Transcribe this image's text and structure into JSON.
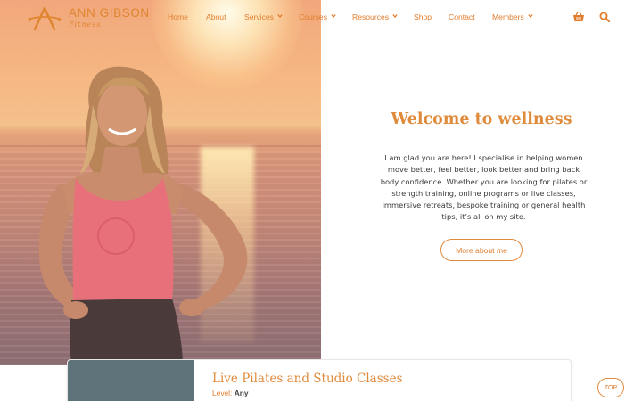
{
  "brand": {
    "name": "ANN GIBSON",
    "tagline": "Fitness",
    "accent_color": "#e07c2c"
  },
  "nav": [
    {
      "label": "Home",
      "dropdown": false
    },
    {
      "label": "About",
      "dropdown": false
    },
    {
      "label": "Services",
      "dropdown": true
    },
    {
      "label": "Courses",
      "dropdown": true
    },
    {
      "label": "Resources",
      "dropdown": true
    },
    {
      "label": "Shop",
      "dropdown": false
    },
    {
      "label": "Contact",
      "dropdown": false
    },
    {
      "label": "Members",
      "dropdown": true
    }
  ],
  "header_icons": {
    "cart": "basket-icon",
    "search": "search-icon"
  },
  "welcome": {
    "title": "Welcome to wellness",
    "body": "I am glad you are here!  I specialise in helping women move better, feel better, look better and bring back body confidence.  Whether you are looking for pilates or strength training, online programs or live classes, immersive retreats, bespoke training or general health tips, it’s all on my site.",
    "button": "More about me"
  },
  "card": {
    "title": "Live Pilates and Studio Classes",
    "level_label": "Level:",
    "level_value": "Any"
  },
  "top_button": "TOP"
}
